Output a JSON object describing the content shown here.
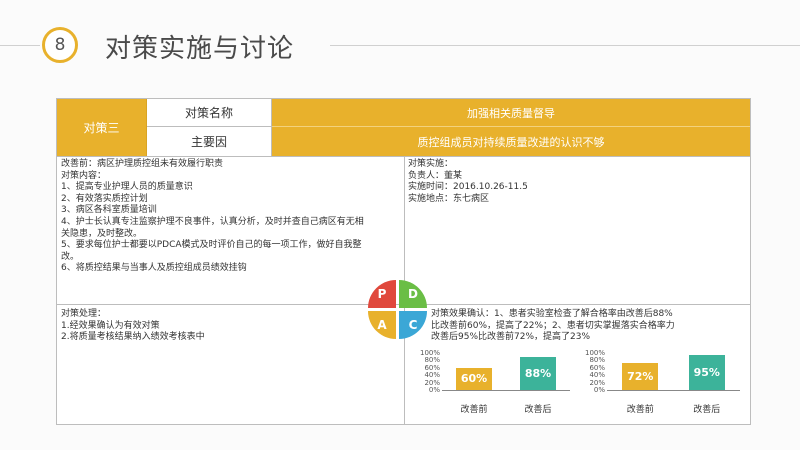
{
  "slide": {
    "number": "8",
    "title": "对策实施与讨论"
  },
  "header": {
    "label": "对策三",
    "name_label": "对策名称",
    "name_value": "加强相关质量督导",
    "cause_label": "主要因",
    "cause_value": "质控组成员对持续质量改进的认识不够"
  },
  "plan": {
    "lines": [
      "改善前：病区护理质控组未有效履行职责",
      "对策内容：",
      "1、提高专业护理人员的质量意识",
      "2、有效落实质控计划",
      "3、病区各科室质量培训",
      "4、护士长认真专注监察护理不良事件，认真分析，及时并查自己病区有无相",
      "关隐患，及时整改。",
      "5、要求每位护士都要以PDCA模式及时评价自己的每一项工作，做好自我整",
      "改。",
      "6、将质控结果与当事人及质控组成员绩效挂钩"
    ]
  },
  "do": {
    "lines": [
      "对策实施：",
      "负责人：董某",
      "实施时间：2016.10.26-11.5",
      "实施地点：东七病区"
    ]
  },
  "act": {
    "lines": [
      "对策处理：",
      "1.经效果确认为有效对策",
      "2.将质量考核结果纳入绩效考核表中"
    ]
  },
  "check": {
    "lines": [
      "对策效果确认：1、患者实验室检查了解合格率由改善后88%",
      "比改善前60%，提高了22%；2、患者切实掌握落实合格率力",
      "改善后95%比改善前72%，提高了23%"
    ]
  },
  "pdca": {
    "p": "P",
    "d": "D",
    "a": "A",
    "c": "C"
  },
  "chart_data": [
    {
      "type": "bar",
      "categories": [
        "改善前",
        "改善后"
      ],
      "values": [
        60,
        88
      ],
      "value_labels": [
        "60%",
        "88%"
      ],
      "ylim": [
        0,
        100
      ],
      "yticks": [
        "100%",
        "80%",
        "60%",
        "40%",
        "20%",
        "0%"
      ],
      "colors": [
        "#e8b12c",
        "#3cb39a"
      ]
    },
    {
      "type": "bar",
      "categories": [
        "改善前",
        "改善后"
      ],
      "values": [
        72,
        95
      ],
      "value_labels": [
        "72%",
        "95%"
      ],
      "ylim": [
        0,
        100
      ],
      "yticks": [
        "100%",
        "80%",
        "60%",
        "40%",
        "20%",
        "0%"
      ],
      "colors": [
        "#e8b12c",
        "#3cb39a"
      ]
    }
  ]
}
